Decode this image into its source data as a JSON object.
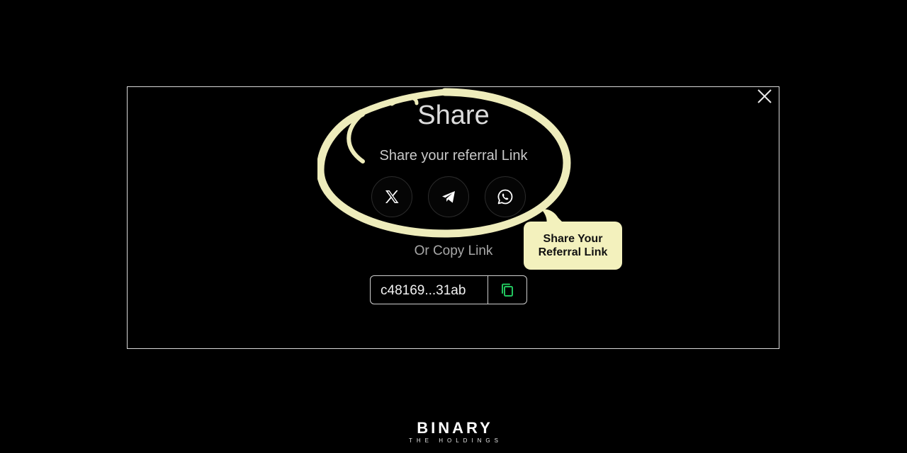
{
  "modal": {
    "title": "Share",
    "subtitle": "Share your referral Link",
    "share_buttons": [
      {
        "icon": "x-twitter-icon",
        "label": "X"
      },
      {
        "icon": "telegram-icon",
        "label": "Telegram"
      },
      {
        "icon": "whatsapp-icon",
        "label": "WhatsApp"
      }
    ],
    "copy_label": "Or Copy Link",
    "link_value": "c48169...31ab",
    "copy_icon": "copy-icon",
    "close_icon": "close-icon"
  },
  "tooltip": {
    "line1": "Share Your",
    "line2": "Referral Link"
  },
  "brand": {
    "name": "BINARY",
    "tagline": "THE HOLDINGS"
  },
  "colors": {
    "background": "#000000",
    "highlight": "#eeecbb",
    "tooltip_bg": "#f3f1bd",
    "copy_icon": "#22c55e",
    "border": "#d9d9d9"
  }
}
